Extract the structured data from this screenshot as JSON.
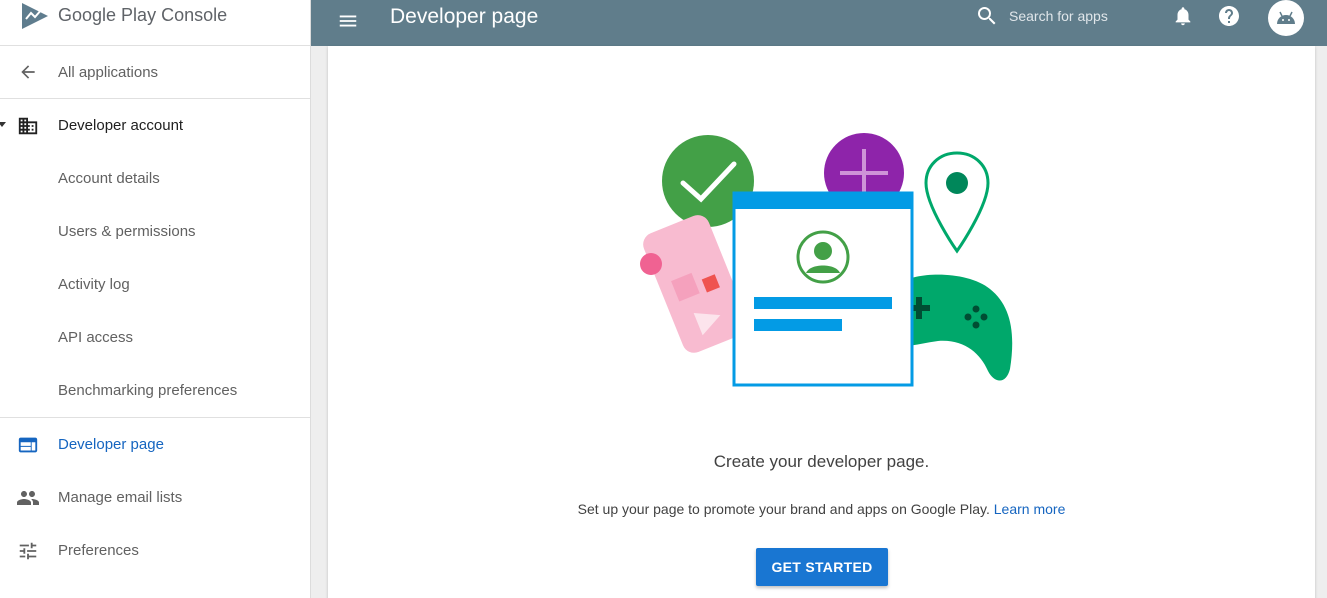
{
  "brand": {
    "name_google": "Google",
    "name_rest": " Play Console"
  },
  "topbar": {
    "title": "Developer page",
    "search_placeholder": "Search for apps"
  },
  "sidebar": {
    "back_label": "All applications",
    "section_label": "Developer account",
    "sub_items": [
      {
        "label": "Account details"
      },
      {
        "label": "Users & permissions"
      },
      {
        "label": "Activity log"
      },
      {
        "label": "API access"
      },
      {
        "label": "Benchmarking preferences"
      }
    ],
    "bottom_items": [
      {
        "label": "Developer page",
        "icon": "web-page-icon",
        "active": true
      },
      {
        "label": "Manage email lists",
        "icon": "people-icon"
      },
      {
        "label": "Preferences",
        "icon": "sliders-icon"
      }
    ]
  },
  "main": {
    "headline": "Create your developer page.",
    "subtext": "Set up your page to promote your brand and apps on Google Play.",
    "learn_more": "Learn more",
    "cta_label": "GET STARTED"
  },
  "colors": {
    "topbar": "#607d8b",
    "accent_blue": "#1976d2",
    "active_text": "#1565c0"
  }
}
